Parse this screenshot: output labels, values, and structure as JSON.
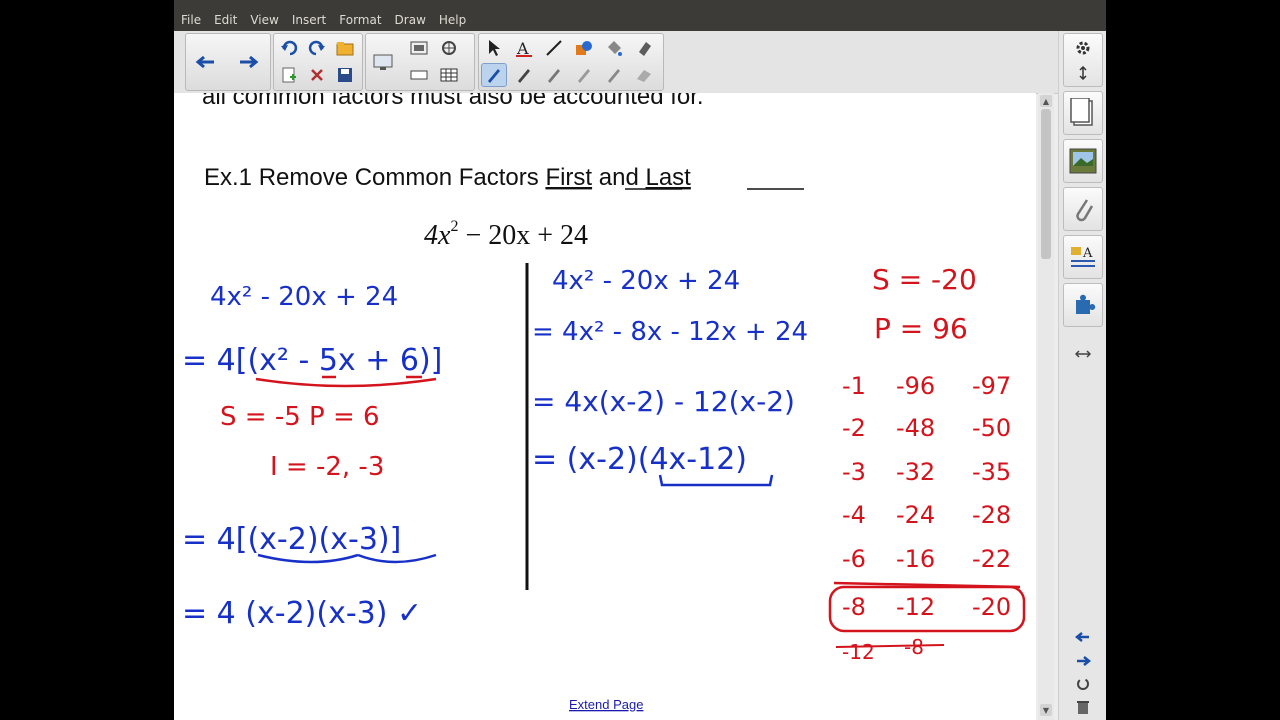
{
  "menu": [
    "File",
    "Edit",
    "View",
    "Insert",
    "Format",
    "Draw",
    "Help"
  ],
  "page": {
    "partial_text": "all common factors must also be accounted for.",
    "heading_prefix": "Ex.1 Remove Common Factors ",
    "heading_first": "First",
    "heading_and": " and ",
    "heading_last": "Last",
    "extend_link": "Extend Page"
  },
  "formula": {
    "coef": "4x",
    "exp": "2",
    "rest": " − 20x + 24"
  },
  "ink_left": {
    "line1": "4x² - 20x + 24",
    "line2": "= 4[(x² - 5x + 6)]",
    "sp": "S = -5   P = 6",
    "roots": "I = -2, -3",
    "line3": "= 4[(x-2)(x-3)]",
    "line4": "= 4 (x-2)(x-3) ✓"
  },
  "ink_middle": {
    "line1": "4x² - 20x + 24",
    "line2": "= 4x² - 8x - 12x + 24",
    "line3": "= 4x(x-2) - 12(x-2)",
    "line4": "= (x-2)(4x-12)"
  },
  "ink_right": {
    "s": "S = -20",
    "p": "P = 96",
    "rows": [
      [
        "-1",
        "-96",
        "-97"
      ],
      [
        "-2",
        "-48",
        "-50"
      ],
      [
        "-3",
        "-32",
        "-35"
      ],
      [
        "-4",
        "-24",
        "-28"
      ],
      [
        "-6",
        "-16",
        "-22"
      ],
      [
        "-8",
        "-12",
        "-20"
      ]
    ],
    "crossed": [
      "-12",
      "-8"
    ]
  },
  "colors": {
    "blue_ink": "#1730c8",
    "red_ink": "#d4141c",
    "black_ink": "#111111",
    "link": "#1a1ab0"
  },
  "icons": {
    "toolbar": [
      "back-arrow-icon",
      "forward-arrow-icon",
      "undo-icon",
      "redo-icon",
      "open-folder-icon",
      "screen-capture-icon",
      "document-camera-icon",
      "select-arrow-icon",
      "text-icon",
      "line-icon",
      "shape-fill-icon",
      "eraser-icon",
      "pen-icon"
    ],
    "side": [
      "page-sorter-icon",
      "gallery-icon",
      "attachments-icon",
      "properties-icon",
      "addons-icon"
    ]
  }
}
